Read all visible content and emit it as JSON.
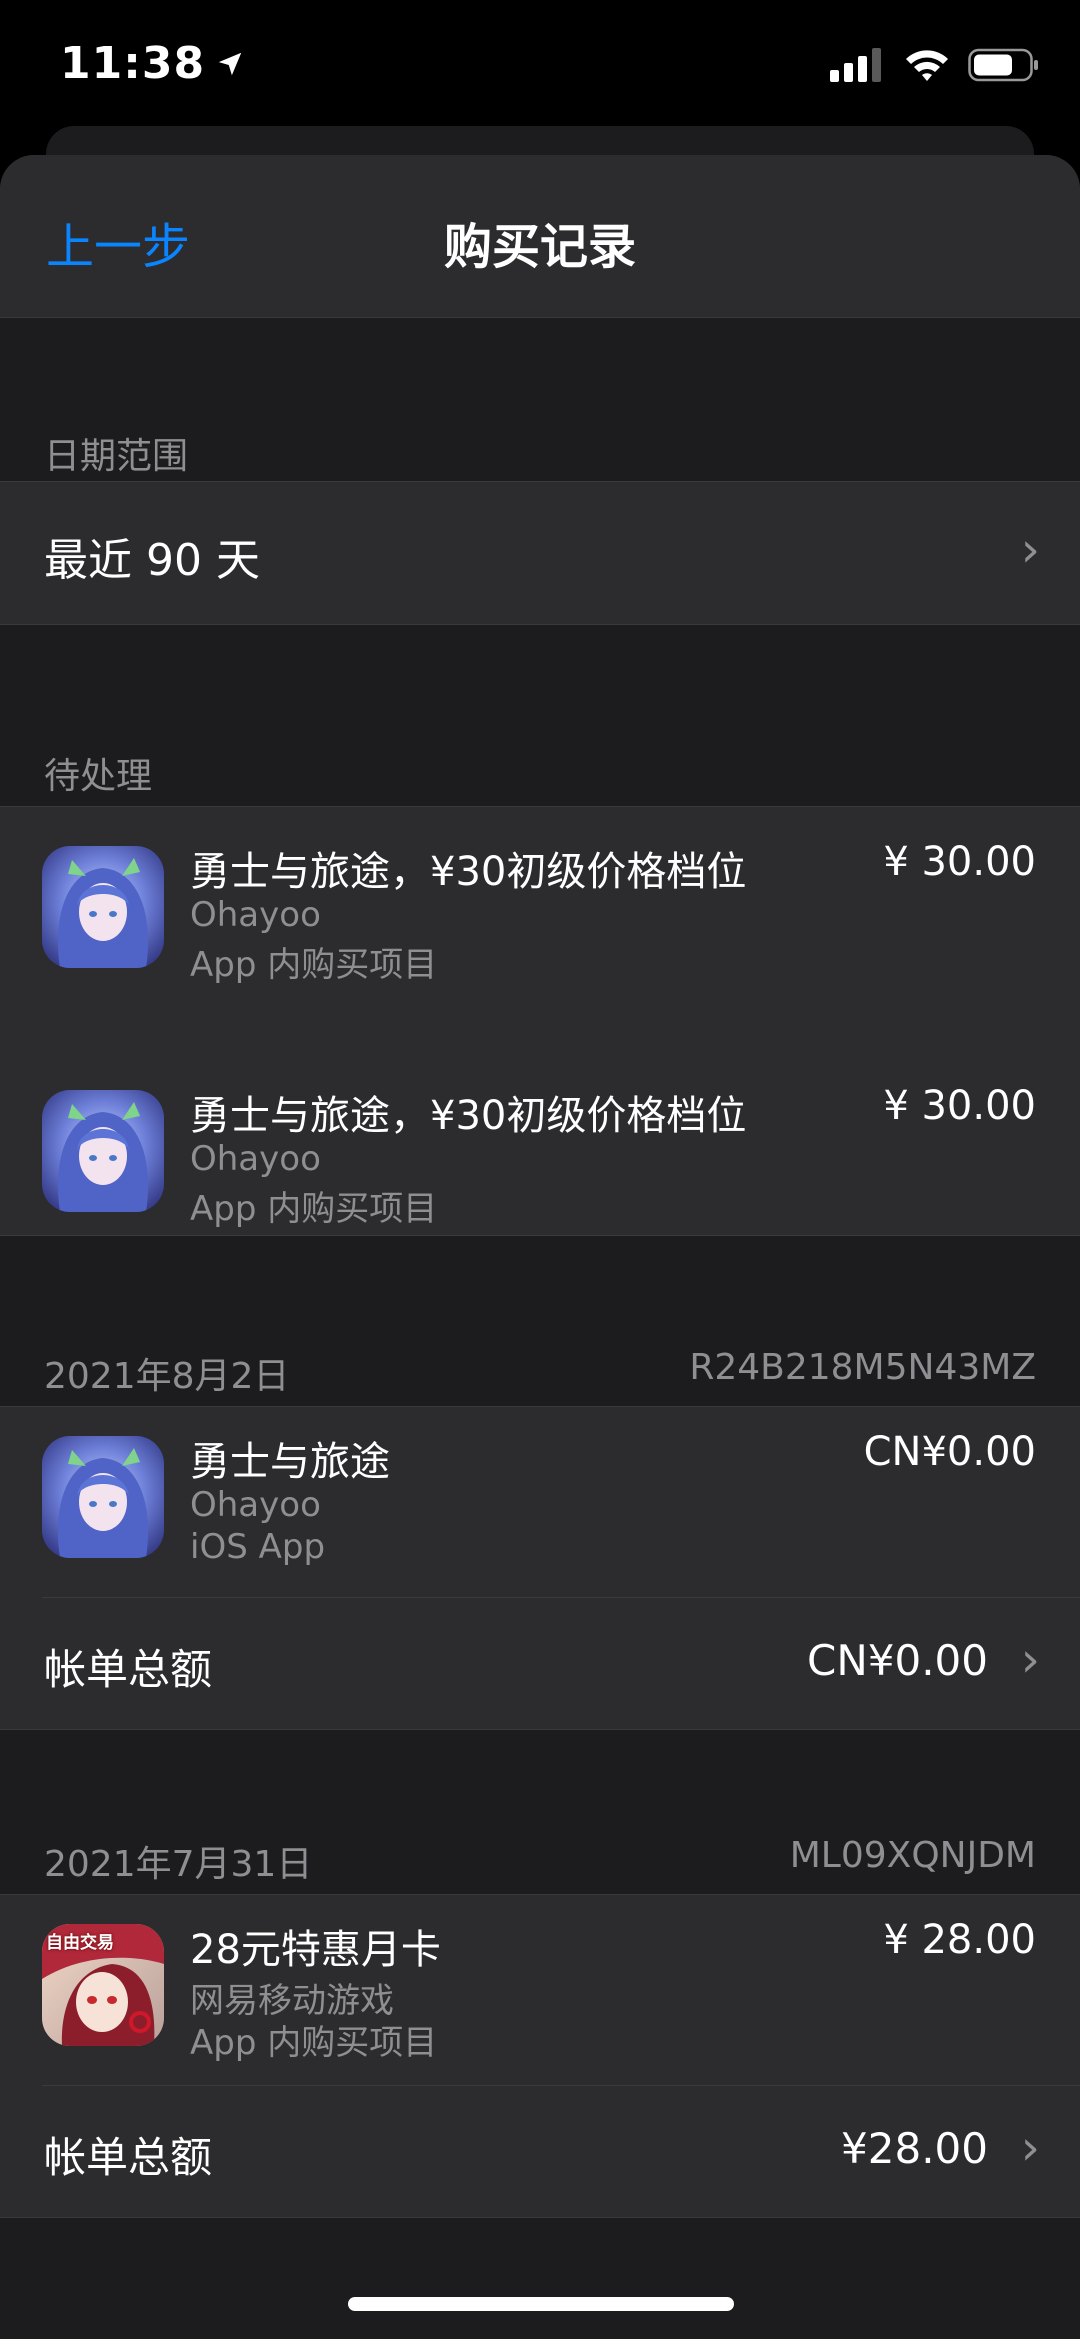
{
  "status": {
    "time": "11:38"
  },
  "nav": {
    "back_label": "上一步",
    "title": "购买记录"
  },
  "date_range": {
    "header": "日期范围",
    "value": "最近 90 天"
  },
  "pending": {
    "header": "待处理",
    "items": [
      {
        "name": "勇士与旅途，¥30初级价格档位",
        "developer": "Ohayoo",
        "type": "App 内购买项目",
        "price": "¥ 30.00"
      },
      {
        "name": "勇士与旅途，¥30初级价格档位",
        "developer": "Ohayoo",
        "type": "App 内购买项目",
        "price": "¥ 30.00"
      }
    ]
  },
  "orders": [
    {
      "date": "2021年8月2日",
      "order_id": "R24B218M5N43MZ",
      "item": {
        "name": "勇士与旅途",
        "developer": "Ohayoo",
        "type": "iOS App",
        "price": "CN¥0.00"
      },
      "total_label": "帐单总额",
      "total": "CN¥0.00"
    },
    {
      "date": "2021年7月31日",
      "order_id": "ML09XQNJDM",
      "item": {
        "name": "28元特惠月卡",
        "developer": "网易移动游戏",
        "type": "App 内购买项目",
        "price": "¥ 28.00",
        "icon_text": "自由交易"
      },
      "total_label": "帐单总额",
      "total": "¥28.00"
    }
  ]
}
